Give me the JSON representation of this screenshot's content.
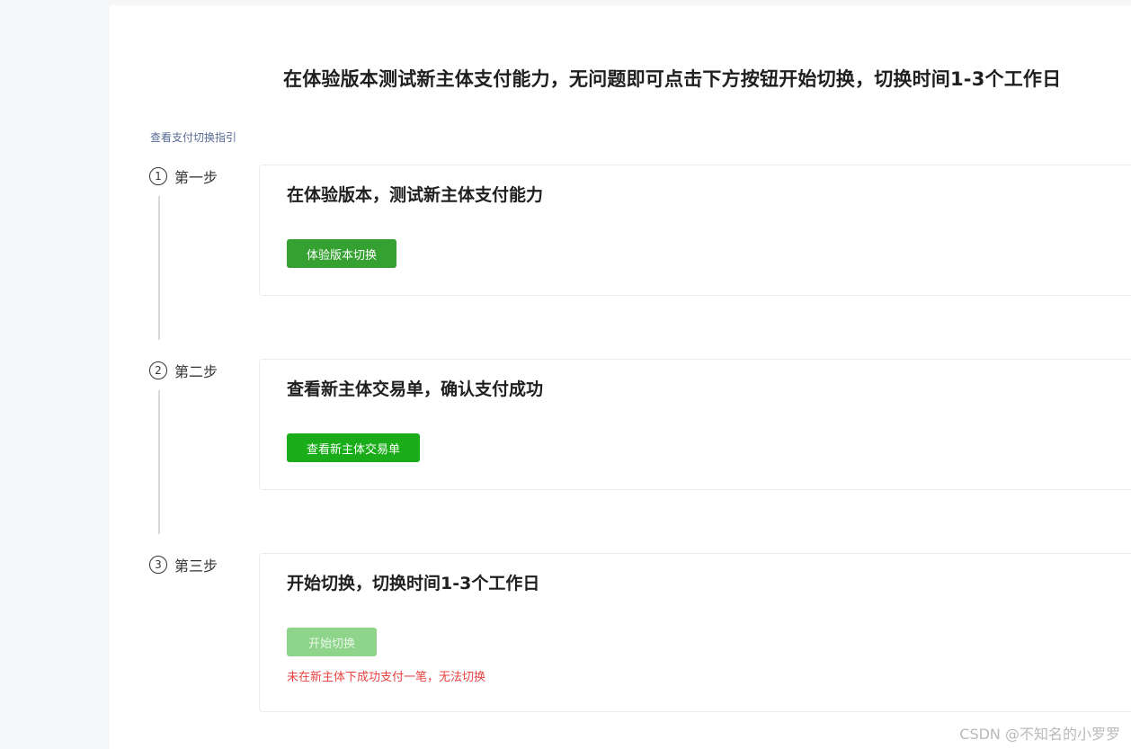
{
  "heading": "在体验版本测试新主体支付能力，无问题即可点击下方按钮开始切换，切换时间1-3个工作日",
  "guide_link": "查看支付切换指引",
  "steps": [
    {
      "number": "1",
      "label": "第一步",
      "title": "在体验版本，测试新主体支付能力",
      "button_label": "体验版本切换"
    },
    {
      "number": "2",
      "label": "第二步",
      "title": "查看新主体交易单，确认支付成功",
      "button_label": "查看新主体交易单"
    },
    {
      "number": "3",
      "label": "第三步",
      "title": "开始切换，切换时间1-3个工作日",
      "button_label": "开始切换",
      "button_disabled": true,
      "warning": "未在新主体下成功支付一笔，无法切换"
    }
  ],
  "watermark": "CSDN @不知名的小罗罗",
  "colors": {
    "primary_green": "#1aad19",
    "button_green_step1": "#35a130",
    "disabled_green": "#8ed58b",
    "warning_red": "#e64340",
    "link_blue": "#576b95"
  }
}
